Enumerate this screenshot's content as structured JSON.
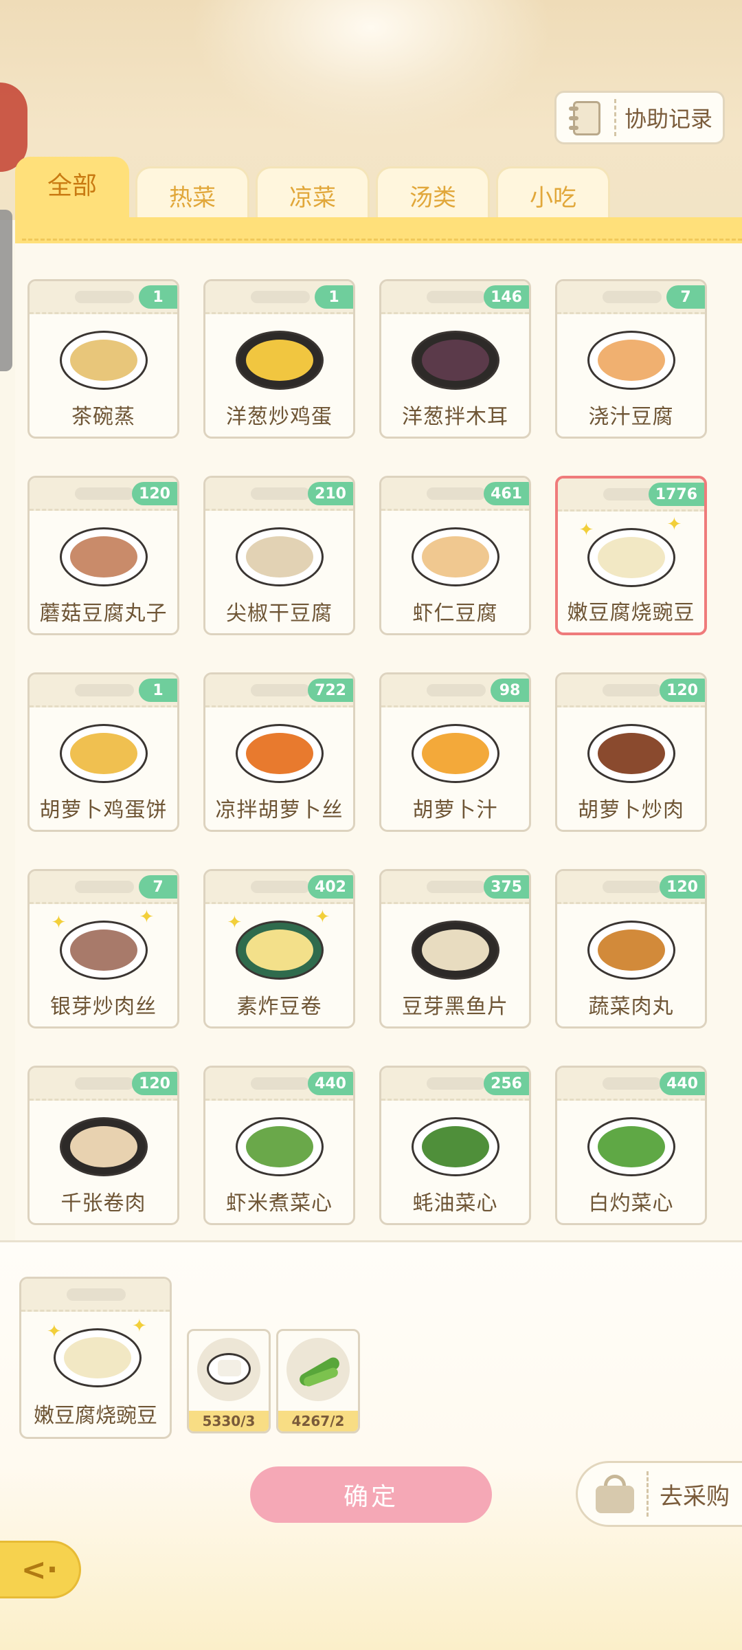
{
  "header": {
    "assist_record_label": "协助记录"
  },
  "tabs": [
    {
      "label": "全部",
      "active": true
    },
    {
      "label": "热菜",
      "active": false
    },
    {
      "label": "凉菜",
      "active": false
    },
    {
      "label": "汤类",
      "active": false
    },
    {
      "label": "小吃",
      "active": false
    }
  ],
  "dishes": [
    {
      "name": "茶碗蒸",
      "count": "1"
    },
    {
      "name": "洋葱炒鸡蛋",
      "count": "1"
    },
    {
      "name": "洋葱拌木耳",
      "count": "146"
    },
    {
      "name": "浇汁豆腐",
      "count": "7"
    },
    {
      "name": "蘑菇豆腐丸子",
      "count": "120"
    },
    {
      "name": "尖椒干豆腐",
      "count": "210"
    },
    {
      "name": "虾仁豆腐",
      "count": "461"
    },
    {
      "name": "嫩豆腐烧豌豆",
      "count": "1776",
      "selected": true
    },
    {
      "name": "胡萝卜鸡蛋饼",
      "count": "1"
    },
    {
      "name": "凉拌胡萝卜丝",
      "count": "722"
    },
    {
      "name": "胡萝卜汁",
      "count": "98"
    },
    {
      "name": "胡萝卜炒肉",
      "count": "120"
    },
    {
      "name": "银芽炒肉丝",
      "count": "7"
    },
    {
      "name": "素炸豆卷",
      "count": "402"
    },
    {
      "name": "豆芽黑鱼片",
      "count": "375"
    },
    {
      "name": "蔬菜肉丸",
      "count": "120"
    },
    {
      "name": "千张卷肉",
      "count": "120"
    },
    {
      "name": "虾米煮菜心",
      "count": "440"
    },
    {
      "name": "蚝油菜心",
      "count": "256"
    },
    {
      "name": "白灼菜心",
      "count": "440"
    }
  ],
  "selected_dish": {
    "name": "嫩豆腐烧豌豆",
    "ingredients": [
      {
        "icon": "tofu-icon",
        "count": "5330/3"
      },
      {
        "icon": "pea-pod-icon",
        "count": "4267/2"
      }
    ]
  },
  "actions": {
    "confirm_label": "确定",
    "shop_label": "去采购"
  },
  "colors": {
    "tab_active": "#ffe07a",
    "badge": "#6fce9c",
    "confirm": "#f5a8b6",
    "selected_border": "#ef7b7b"
  }
}
